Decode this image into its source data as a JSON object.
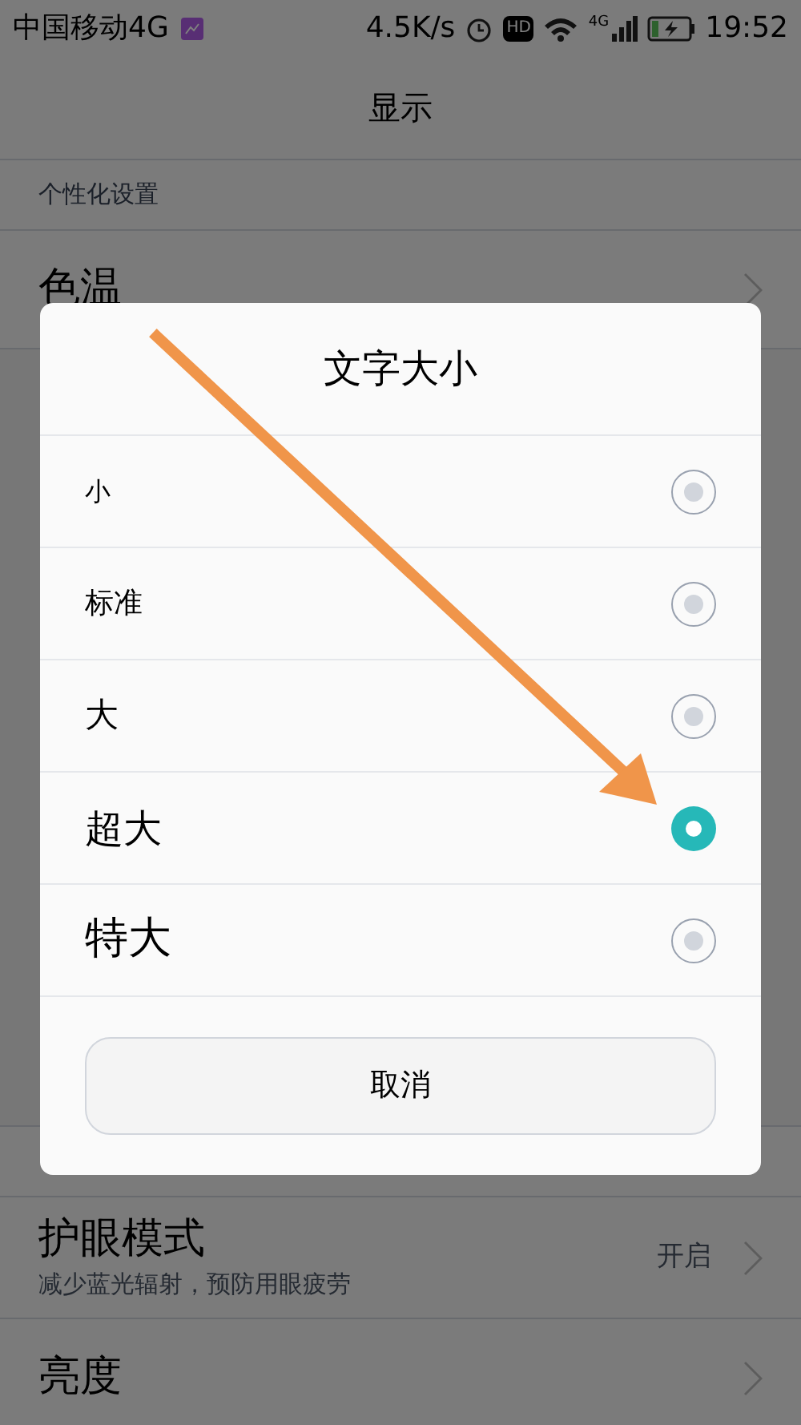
{
  "status_bar": {
    "carrier": "中国移动4G",
    "speed": "4.5K/s",
    "hd": "HD",
    "network": "4G",
    "time": "19:52"
  },
  "header": {
    "title": "显示"
  },
  "section": {
    "title": "个性化设置"
  },
  "background_rows": [
    {
      "title": "色温",
      "kind": "plain"
    },
    {
      "title": "护眼模式",
      "subtitle": "减少蓝光辐射，预防用眼疲劳",
      "value": "开启",
      "kind": "detail"
    },
    {
      "title": "亮度",
      "kind": "plain"
    }
  ],
  "dialog": {
    "title": "文字大小",
    "options": [
      {
        "label": "小",
        "selected": false
      },
      {
        "label": "标准",
        "selected": false
      },
      {
        "label": "大",
        "selected": false
      },
      {
        "label": "超大",
        "selected": true
      },
      {
        "label": "特大",
        "selected": false
      }
    ],
    "cancel": "取消"
  }
}
